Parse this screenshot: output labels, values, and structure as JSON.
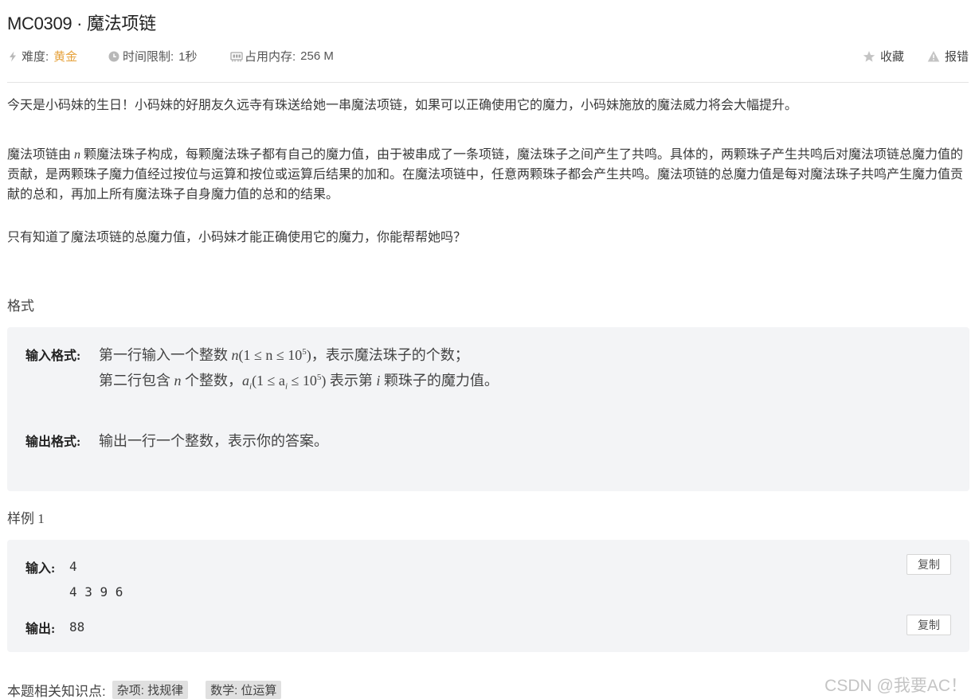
{
  "problem": {
    "code": "MC0309",
    "separator": " · ",
    "name": "魔法项链"
  },
  "meta": {
    "difficulty_label": "难度:",
    "difficulty_value": "黄金",
    "time_label": "时间限制:",
    "time_value": "1秒",
    "memory_label": "占用内存:",
    "memory_value": "256 M",
    "favorite_label": "收藏",
    "report_label": "报错",
    "difficulty_color": "#e6a23c"
  },
  "description": {
    "p1": "今天是小码妹的生日！小码妹的好朋友久远寺有珠送给她一串魔法项链，如果可以正确使用它的魔力，小码妹施放的魔法威力将会大幅提升。",
    "p2_before": "魔法项链由 ",
    "p2_var": "n",
    "p2_after": " 颗魔法珠子构成，每颗魔法珠子都有自己的魔力值，由于被串成了一条项链，魔法珠子之间产生了共鸣。具体的，两颗珠子产生共鸣后对魔法项链总魔力值的贡献，是两颗珠子魔力值经过按位与运算和按位或运算后结果的加和。在魔法项链中，任意两颗珠子都会产生共鸣。魔法项链的总魔力值是每对魔法珠子共鸣产生魔力值贡献的总和，再加上所有魔法珠子自身魔力值的总和的结果。",
    "p3": "只有知道了魔法项链的总魔力值，小码妹才能正确使用它的魔力，你能帮帮她吗？"
  },
  "format": {
    "section_title": "格式",
    "input_label": "输入格式:",
    "input_line1_a": "第一行输入一个整数 ",
    "input_line1_var": "n",
    "input_line1_math": "(1 ≤ n ≤ 10",
    "input_line1_exp": "5",
    "input_line1_close": ")",
    "input_line1_b": "，表示魔法珠子的个数；",
    "input_line2_a": "第二行包含 ",
    "input_line2_var": "n",
    "input_line2_b": " 个整数，",
    "input_line2_var2": "a",
    "input_line2_sub": "i",
    "input_line2_math": "(1 ≤ a",
    "input_line2_math2": " ≤ 10",
    "input_line2_exp": "5",
    "input_line2_close": ")",
    "input_line2_c": " 表示第 ",
    "input_line2_var3": "i",
    "input_line2_d": " 颗珠子的魔力值。",
    "output_label": "输出格式:",
    "output_text": "输出一行一个整数，表示你的答案。"
  },
  "sample": {
    "section_title": "样例 1",
    "input_label": "输入:",
    "input_line1": "4",
    "input_line2": "4 3 9 6",
    "output_label": "输出:",
    "output_value": "88",
    "copy_label": "复制"
  },
  "knowledge": {
    "label": "本题相关知识点:",
    "tags": [
      "杂项: 找规律",
      "数学: 位运算"
    ]
  },
  "watermark": "CSDN @我要AC！"
}
